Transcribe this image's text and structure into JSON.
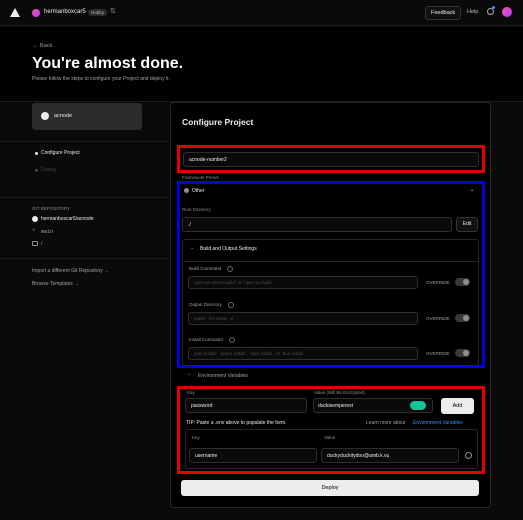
{
  "topbar": {
    "username": "hermanboxcar5",
    "plan_badge": "Hobby",
    "feedback_label": "Feedback",
    "help_label": "Help"
  },
  "hero": {
    "back_label": "← Back",
    "title": "You're almost done.",
    "subtitle": "Please follow the steps to configure your Project and deploy it."
  },
  "left": {
    "repo_card_name": "acnode",
    "steps": [
      "Configure Project",
      "Deploy"
    ],
    "git_section_label": "GIT REPOSITORY",
    "repo_full": "hermanboxcar5/acnode",
    "branch": "main",
    "root_path": "/",
    "import_link": "Import a different Git Repository →",
    "templates_link": "Browse Templates →"
  },
  "config": {
    "title": "Configure Project",
    "project_name": "acnode-number2",
    "framework_label": "Framework Preset",
    "framework_value": "Other",
    "root_dir_label": "Root Directory",
    "root_dir_value": "./",
    "edit_label": "Edit",
    "build_section": "Build and Output Settings",
    "build_command_label": "Build Command",
    "build_command_placeholder": "npm run vercel-build` or `npm run build`",
    "output_dir_label": "Output Directory",
    "output_dir_placeholder": "public` if it exists, or `.`",
    "install_command_label": "Install Command",
    "install_command_placeholder": "yarn install`, `pnpm install`, `npm install`, or `bun install`",
    "override_label": "OVERRIDE",
    "env_section": "Environment Variables",
    "key_label": "Key",
    "value_label": "Value (Will Be Encrypted)",
    "new_key": "password",
    "new_value": "duckisemperest",
    "add_label": "Add",
    "tip_text": "TIP: Paste a .env above to populate the form.",
    "learn_more": "Learn more about",
    "env_link": "Environment Variables",
    "table_key_header": "Key",
    "table_value_header": "Value",
    "row_key": "username",
    "row_value": "duckyduckitydoo@amb.k.vu",
    "deploy_label": "Deploy"
  },
  "colors": {
    "annotation_red": "#e50000",
    "annotation_blue": "#0000e0",
    "grammarly": "#15c39a"
  }
}
